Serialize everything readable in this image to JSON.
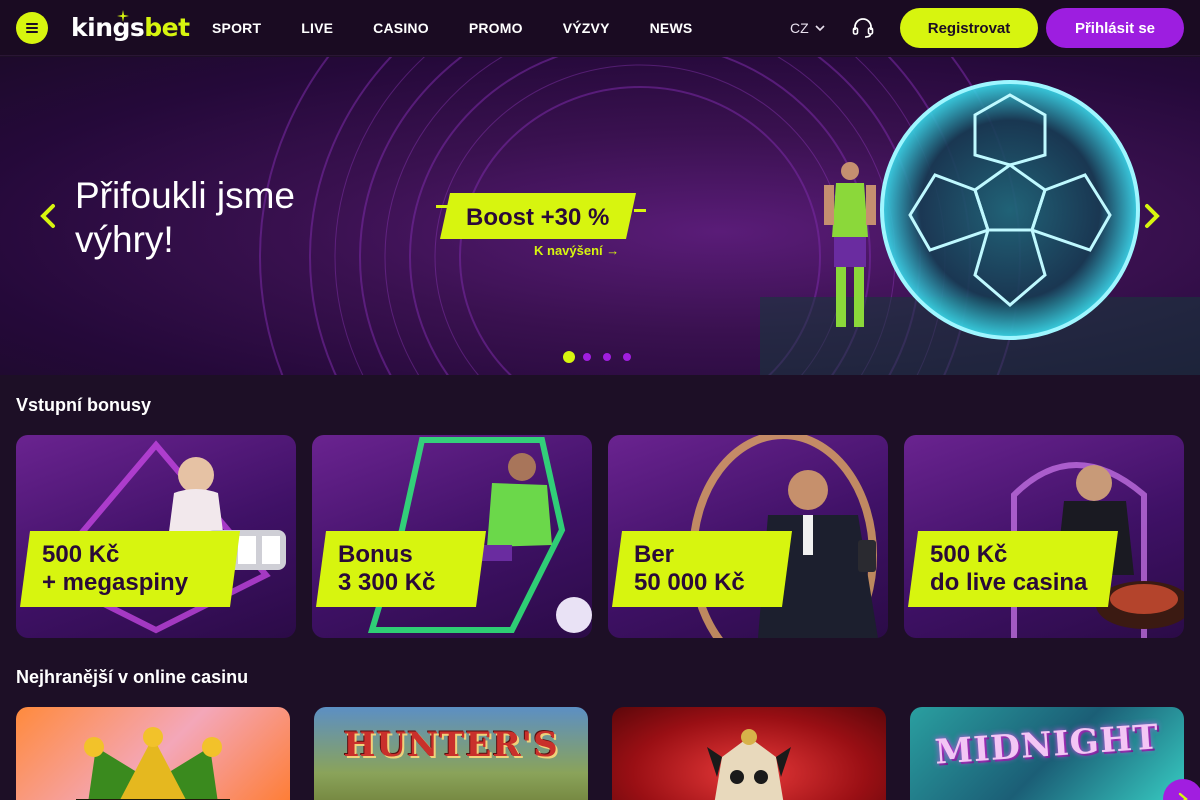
{
  "header": {
    "logo_a": "kings",
    "logo_b": "bet",
    "nav": [
      "SPORT",
      "LIVE",
      "CASINO",
      "PROMO",
      "VÝZVY",
      "NEWS"
    ],
    "language": "CZ",
    "register_label": "Registrovat",
    "login_label": "Přihlásit se"
  },
  "hero": {
    "title": "Přifoukli jsme výhry!",
    "boost": "Boost +30 %",
    "boost_link": "K navýšení →",
    "slides": 4,
    "active_slide": 1
  },
  "bonuses": {
    "title": "Vstupní bonusy",
    "cards": [
      {
        "line1": "500 Kč",
        "line2": "+ megaspiny"
      },
      {
        "line1": "Bonus",
        "line2": "3 300 Kč"
      },
      {
        "line1": "Ber",
        "line2": "50 000 Kč"
      },
      {
        "line1": "500 Kč",
        "line2": "do live casina"
      }
    ]
  },
  "games": {
    "title": "Nejhranější v online casinu",
    "cards": [
      {
        "title": ""
      },
      {
        "title": "HUNTER'S"
      },
      {
        "title": ""
      },
      {
        "title": "MIDNIGHT"
      }
    ]
  },
  "colors": {
    "accent": "#d7f50f",
    "brand_purple": "#9d1ee0",
    "background": "#1d0f26"
  }
}
